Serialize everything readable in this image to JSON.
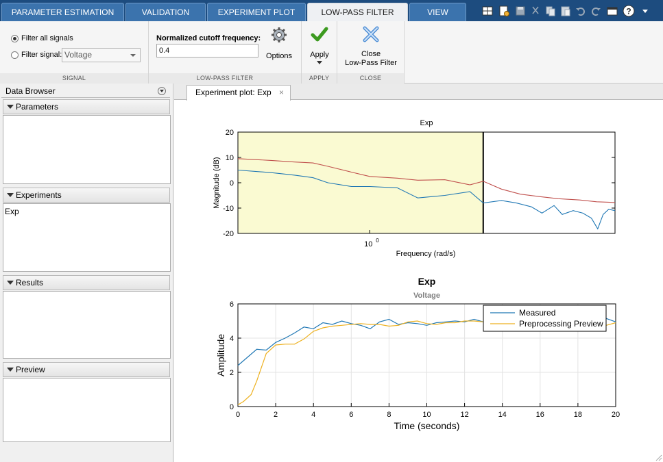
{
  "tabs": [
    {
      "label": "PARAMETER ESTIMATION",
      "active": false
    },
    {
      "label": "VALIDATION",
      "active": false
    },
    {
      "label": "EXPERIMENT PLOT",
      "active": false
    },
    {
      "label": "LOW-PASS FILTER",
      "active": true
    },
    {
      "label": "VIEW",
      "active": false
    }
  ],
  "quick_access": [
    "layout-icon",
    "new-doc-icon",
    "save-icon",
    "cut-icon",
    "copy-icon",
    "paste-icon",
    "undo-icon",
    "redo-icon",
    "window-icon",
    "help-icon",
    "menu-arrow-icon"
  ],
  "ribbon": {
    "signal": {
      "filter_all_label": "Filter all signals",
      "filter_signal_label": "Filter signal:",
      "signal_value": "Voltage",
      "footer": "SIGNAL"
    },
    "lowpass": {
      "cutoff_label": "Normalized cutoff frequency:",
      "cutoff_value": "0.4",
      "options_label": "Options",
      "footer": "LOW-PASS FILTER"
    },
    "apply": {
      "label": "Apply",
      "footer": "APPLY"
    },
    "close": {
      "label_line1": "Close",
      "label_line2": "Low-Pass Filter",
      "footer": "CLOSE"
    }
  },
  "browser": {
    "title": "Data Browser",
    "panels": [
      {
        "title": "Parameters",
        "items": []
      },
      {
        "title": "Experiments",
        "items": [
          "Exp"
        ]
      },
      {
        "title": "Results",
        "items": []
      },
      {
        "title": "Preview",
        "items": []
      }
    ]
  },
  "document_tab": {
    "label": "Experiment plot: Exp",
    "close_glyph": "×"
  },
  "colors": {
    "measured": "#1f77b4",
    "preview": "#edb120",
    "upper_curve": "#c0504d",
    "passband_fill": "#fafad2"
  },
  "chart_data": [
    {
      "type": "line",
      "title": "Exp",
      "xlabel": "Frequency  (rad/s)",
      "ylabel": "Magnitude (dB)",
      "x_scale": "log",
      "xlim": [
        0.2,
        20
      ],
      "ylim": [
        -20,
        20
      ],
      "yticks": [
        -20,
        -10,
        0,
        10,
        20
      ],
      "xticks": [
        {
          "value": 1,
          "base": "10",
          "exp": "0"
        }
      ],
      "passband_upper": 4.0,
      "series": [
        {
          "values_x": [
            0.2,
            0.3,
            0.4,
            0.5,
            0.6,
            0.8,
            1.0,
            1.4,
            1.8,
            2.5,
            3.4,
            4.0,
            5.0,
            6.3,
            8.0,
            10,
            13,
            16,
            20
          ],
          "values": [
            9.5,
            8.8,
            8.2,
            7.8,
            6.5,
            4.2,
            2.5,
            1.8,
            1.0,
            1.2,
            -0.8,
            0.6,
            -2.5,
            -4.5,
            -5.5,
            -6.3,
            -6.8,
            -7.5,
            -7.8
          ]
        },
        {
          "values_x": [
            0.2,
            0.3,
            0.4,
            0.5,
            0.6,
            0.8,
            1.0,
            1.4,
            1.8,
            2.5,
            3.4,
            4.0,
            5.0,
            6.0,
            7.2,
            8.2,
            9.5,
            10.5,
            12,
            13.5,
            15,
            16.2,
            17.3,
            18.5,
            20
          ],
          "values": [
            5,
            4,
            3,
            2,
            0,
            -1.5,
            -1.5,
            -2,
            -6,
            -5,
            -3.5,
            -8,
            -7,
            -8,
            -9.5,
            -12,
            -9,
            -12.5,
            -11,
            -12,
            -14,
            -18.2,
            -12.5,
            -10.5,
            -11
          ]
        }
      ]
    },
    {
      "type": "line",
      "title": "Exp",
      "subtitle": "Voltage",
      "xlabel": "Time (seconds)",
      "ylabel": "Amplitude",
      "xlim": [
        0,
        20
      ],
      "ylim": [
        0,
        6
      ],
      "xticks": [
        0,
        2,
        4,
        6,
        8,
        10,
        12,
        14,
        16,
        18,
        20
      ],
      "yticks": [
        0,
        2,
        4,
        6
      ],
      "grid": true,
      "legend_position": "top-right",
      "series": [
        {
          "name": "Measured",
          "x": [
            0,
            1,
            1.5,
            2,
            2.5,
            3,
            3.5,
            4,
            4.5,
            5,
            5.5,
            6,
            6.5,
            7,
            7.5,
            8,
            8.5,
            9,
            9.5,
            10,
            10.5,
            11,
            11.5,
            12,
            12.5,
            13,
            13.5,
            14,
            14.5,
            15,
            15.5,
            16,
            16.5,
            17,
            17.5,
            18,
            18.5,
            19,
            19.5,
            20
          ],
          "values": [
            2.4,
            3.35,
            3.3,
            3.75,
            4.0,
            4.3,
            4.65,
            4.55,
            4.9,
            4.8,
            5.0,
            4.85,
            4.75,
            4.55,
            4.95,
            5.1,
            4.8,
            4.9,
            4.85,
            4.75,
            4.9,
            4.95,
            5.0,
            4.95,
            5.1,
            4.95,
            5.0,
            5.05,
            4.9,
            4.95,
            4.9,
            5.05,
            4.95,
            4.9,
            5.05,
            4.9,
            5.0,
            4.95,
            5.15,
            4.95
          ]
        },
        {
          "name": "Preprocessing Preview",
          "x": [
            0,
            0.3,
            0.7,
            1.0,
            1.5,
            2,
            2.5,
            3,
            3.5,
            4,
            4.5,
            5,
            5.5,
            6,
            6.5,
            7,
            7.5,
            8,
            8.5,
            9,
            9.5,
            10,
            10.5,
            11,
            11.5,
            12,
            12.5,
            13,
            13.5,
            14,
            14.5,
            15,
            15.5,
            16,
            16.5,
            17,
            17.5,
            18,
            18.5,
            19,
            19.5,
            20
          ],
          "values": [
            0.1,
            0.3,
            0.7,
            1.5,
            3.1,
            3.6,
            3.65,
            3.65,
            3.95,
            4.4,
            4.6,
            4.7,
            4.75,
            4.8,
            4.85,
            4.8,
            4.8,
            4.7,
            4.75,
            4.95,
            5.0,
            4.85,
            4.8,
            4.9,
            4.9,
            5.0,
            5.0,
            4.95,
            5.0,
            4.95,
            4.95,
            4.9,
            4.95,
            4.9,
            4.95,
            4.9,
            4.95,
            4.9,
            4.95,
            4.9,
            4.75,
            4.9
          ]
        }
      ]
    }
  ]
}
